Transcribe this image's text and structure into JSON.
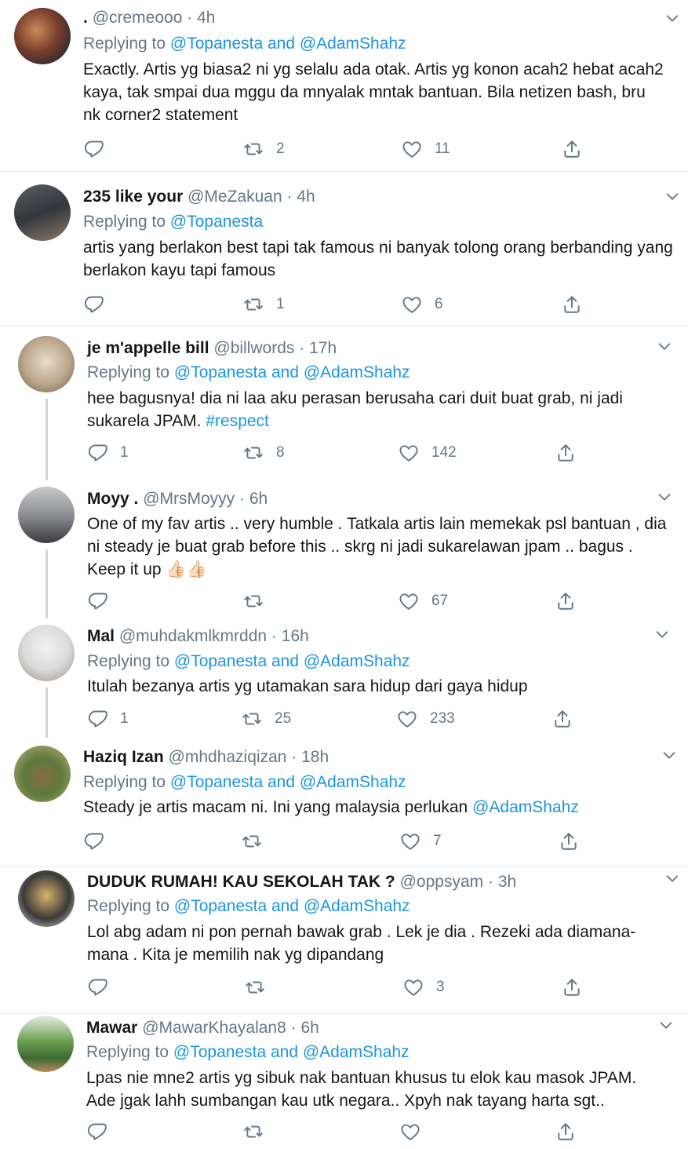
{
  "tweets": [
    {
      "name": ".",
      "handle": "@cremeooo",
      "time": "4h",
      "reply_prefix": "Replying to",
      "reply_to": "@Topanesta and @AdamShahz",
      "text": "Exactly. Artis yg biasa2 ni yg selalu ada otak. Artis yg konon acah2 hebat acah2 kaya, tak smpai dua mggu da mnyalak mntak bantuan. Bila netizen bash, bru nk corner2 statement",
      "replies": "",
      "retweets": "2",
      "likes": "11"
    },
    {
      "name": "235 like your",
      "handle": "@MeZakuan",
      "time": "4h",
      "reply_prefix": "Replying to",
      "reply_to": "@Topanesta",
      "text": "artis yang berlakon best tapi tak famous ni banyak tolong orang berbanding yang berlakon kayu tapi famous",
      "replies": "",
      "retweets": "1",
      "likes": "6"
    },
    {
      "name": "je m'appelle bill",
      "handle": "@billwords",
      "time": "17h",
      "reply_prefix": "Replying to",
      "reply_to": "@Topanesta and @AdamShahz",
      "text": "hee bagusnya! dia ni laa aku perasan berusaha cari duit buat grab, ni jadi sukarela JPAM.",
      "hashtag": "#respect",
      "replies": "1",
      "retweets": "8",
      "likes": "142"
    },
    {
      "name": "Moyy .",
      "handle": "@MrsMoyyy",
      "time": "6h",
      "text": "One of my fav artis .. very humble . Tatkala artis lain memekak psl bantuan , dia ni steady je buat grab before this .. skrg ni jadi sukarelawan jpam .. bagus . Keep it up",
      "emoji": "👍🏻👍🏻",
      "replies": "",
      "retweets": "",
      "likes": "67"
    },
    {
      "name": "Mal",
      "handle": "@muhdakmlkmrddn",
      "time": "16h",
      "reply_prefix": "Replying to",
      "reply_to": "@Topanesta and @AdamShahz",
      "text": "Itulah bezanya artis yg utamakan sara hidup dari gaya hidup",
      "replies": "1",
      "retweets": "25",
      "likes": "233"
    },
    {
      "name": "Haziq Izan",
      "handle": "@mhdhaziqizan",
      "time": "18h",
      "reply_prefix": "Replying to",
      "reply_to": "@Topanesta and @AdamShahz",
      "text": "Steady je artis macam ni. Ini yang malaysia perlukan",
      "text_mention": "@AdamShahz",
      "replies": "",
      "retweets": "",
      "likes": "7"
    },
    {
      "name": "DUDUK RUMAH! KAU SEKOLAH TAK ?",
      "handle": "@oppsyam",
      "time": "3h",
      "reply_prefix": "Replying to",
      "reply_to": "@Topanesta and @AdamShahz",
      "text": "Lol abg adam ni pon pernah bawak grab . Lek je dia . Rezeki ada diamana-mana . Kita je memilih nak yg dipandang",
      "replies": "",
      "retweets": "",
      "likes": "3"
    },
    {
      "name": "Mawar",
      "handle": "@MawarKhayalan8",
      "time": "6h",
      "reply_prefix": "Replying to",
      "reply_to": "@Topanesta and @AdamShahz",
      "text": "Lpas nie mne2 artis yg sibuk nak bantuan khusus tu elok kau masok JPAM. Ade jgak lahh sumbangan kau utk negara.. Xpyh nak tayang harta sgt..",
      "replies": "",
      "retweets": "",
      "likes": ""
    }
  ],
  "colors": {
    "link": "#1b95e0",
    "muted": "#657786",
    "divider": "#e6ecf0"
  },
  "icons": [
    "chevron-down-icon",
    "reply-icon",
    "retweet-icon",
    "like-icon",
    "share-icon"
  ]
}
